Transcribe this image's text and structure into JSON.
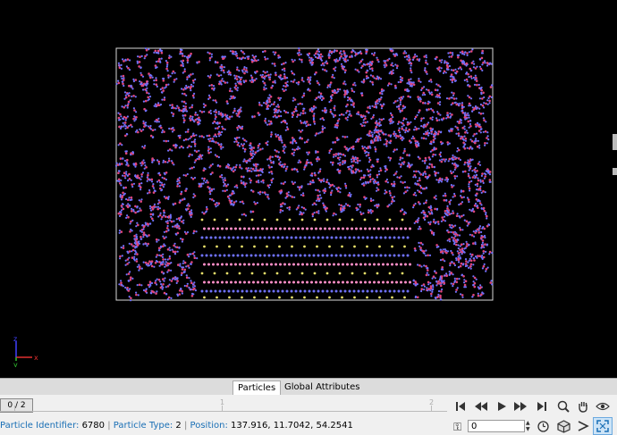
{
  "tabs": [
    {
      "label": "Particles",
      "active": true
    },
    {
      "label": "Global Attributes",
      "active": false
    }
  ],
  "animation": {
    "frame_indicator": "0 / 2",
    "timeline_ticks": [
      "1",
      "2"
    ],
    "current_frame": "0"
  },
  "status": {
    "identifier_label": "Particle Identifier:",
    "identifier_value": "6780",
    "type_label": "Particle Type:",
    "type_value": "2",
    "position_label": "Position:",
    "position_value": "137.916, 11.7042, 54.2541",
    "separator": "|"
  },
  "axes": {
    "x_label": "x",
    "y_label": "y",
    "z_label": "z"
  },
  "colors": {
    "background": "#000000",
    "particle_blue": "#6f72ff",
    "particle_red": "#e0457a",
    "particle_yellow": "#e8e06a",
    "particle_pink": "#ff8fc8",
    "accent_blue": "#1a6fb5",
    "axis_x": "#e03030",
    "axis_y": "#30c030",
    "axis_z": "#4040ff"
  },
  "icons": {
    "jump_start": "jump-to-start-icon",
    "prev_frame": "previous-frame-icon",
    "play": "play-icon",
    "next_frame": "next-frame-icon",
    "jump_end": "jump-to-end-icon",
    "zoom": "zoom-icon",
    "pan": "pan-hand-icon",
    "orbit": "eye-orbit-icon",
    "key": "key-icon",
    "clock": "clock-icon",
    "cube": "view-cube-icon",
    "pick": "pick-arrow-icon",
    "fit": "zoom-fit-icon"
  }
}
